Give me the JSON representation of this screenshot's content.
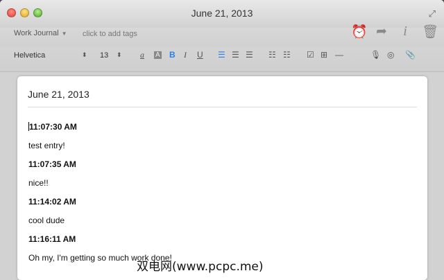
{
  "window": {
    "title": "June 21, 2013"
  },
  "tagbar": {
    "journal": "Work Journal",
    "tags_placeholder": "click to add tags"
  },
  "formatbar": {
    "font": "Helvetica",
    "size": "13"
  },
  "page": {
    "title": "June 21, 2013",
    "entries": [
      {
        "time": "11:07:30 AM",
        "text": "test entry!"
      },
      {
        "time": "11:07:35 AM",
        "text": "nice!!"
      },
      {
        "time": "11:14:02 AM",
        "text": "cool dude"
      },
      {
        "time": "11:16:11 AM",
        "text": "Oh my, I'm getting so much work done!"
      }
    ]
  },
  "watermark": "双电网(www.pcpc.me)",
  "icons": {
    "reminder": "alarm-icon",
    "share": "share-icon",
    "info": "info-icon",
    "trash": "trash-icon",
    "microphone": "microphone-icon",
    "camera": "camera-icon",
    "attach": "paperclip-icon"
  },
  "colors": {
    "accent": "#2b7de9",
    "page": "#ffffff",
    "chrome": "#d2d2d2"
  }
}
